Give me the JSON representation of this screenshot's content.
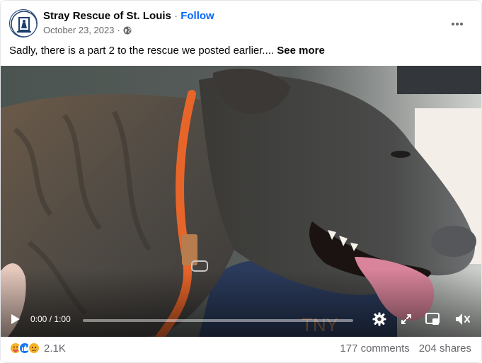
{
  "post": {
    "page_name": "Stray Rescue of St. Louis",
    "separator": "·",
    "follow_label": "Follow",
    "date": "October 23, 2023",
    "date_separator": "·",
    "caption_text": "Sadly, there is a part 2 to the rescue we posted earlier.... ",
    "see_more_label": "See more"
  },
  "icons": {
    "audience": "globe-icon",
    "menu": "more-options-icon",
    "play": "play-icon",
    "settings": "gear-icon",
    "fullscreen": "expand-icon",
    "pip": "picture-in-picture-icon",
    "volume": "speaker-muted-icon"
  },
  "video": {
    "current_time": "0:00",
    "time_separator": "/",
    "duration": "1:00",
    "progress": 0.0
  },
  "engagement": {
    "reactions": [
      "care",
      "like",
      "sad"
    ],
    "reaction_count": "2.1K",
    "comments": "177 comments",
    "shares": "204 shares"
  },
  "colors": {
    "accent": "#0866ff",
    "like": "#1877f2",
    "care": "#f7b125",
    "sad": "#f7b125",
    "collar": "#e8652a"
  }
}
